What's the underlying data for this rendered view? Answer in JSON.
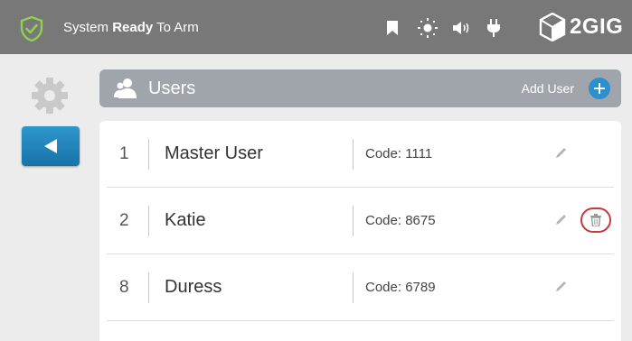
{
  "status": {
    "prefix": "System ",
    "bold": "Ready",
    "suffix": " To Arm"
  },
  "brand": {
    "logo_text": "2GIG"
  },
  "top_icons": [
    "bookmark-icon",
    "brightness-icon",
    "volume-icon",
    "power-plug-icon"
  ],
  "header": {
    "title": "Users",
    "add_label": "Add User"
  },
  "users": [
    {
      "number": "1",
      "name": "Master User",
      "code": "Code: 1111",
      "deletable": false
    },
    {
      "number": "2",
      "name": "Katie",
      "code": "Code: 8675",
      "deletable": true
    },
    {
      "number": "8",
      "name": "Duress",
      "code": "Code: 6789",
      "deletable": false
    }
  ],
  "colors": {
    "topbar": "#787878",
    "accent": "#2b8fd0",
    "shield": "#8fd14f",
    "delete": "#c8373a"
  }
}
